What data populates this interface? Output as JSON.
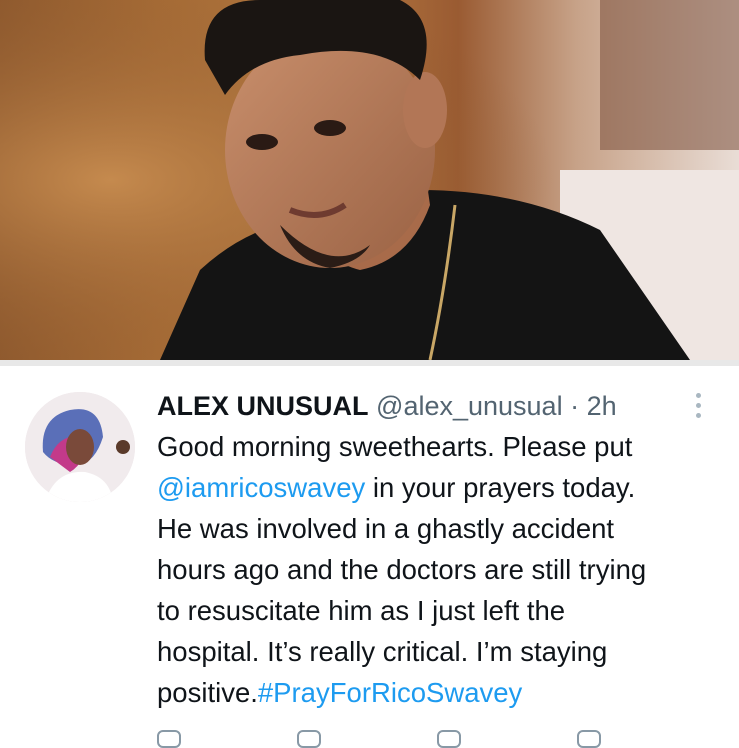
{
  "photo": {
    "subject": "Portrait of a young man with styled hair wearing a black shirt and a thin gold chain"
  },
  "tweet": {
    "author_name": "ALEX UNUSUAL",
    "handle": "@alex_unusual",
    "separator": "·",
    "time": "2h",
    "text_lines": [
      "Good morning sweethearts. Please put",
      {
        "mention": "@iamricoswavey",
        "rest": " in your prayers today."
      },
      "He was involved in a ghastly accident",
      "hours ago and the doctors are still trying",
      "to resuscitate him as I just left the",
      "hospital. It’s really critical. I’m staying",
      {
        "prefix": "positive.",
        "hashtag": "#PrayForRicoSwavey"
      }
    ]
  },
  "icons": {
    "more": "more-vertical-icon",
    "actions": [
      "reply-icon",
      "retweet-icon",
      "like-icon",
      "share-icon"
    ]
  },
  "colors": {
    "link": "#1d9bf0",
    "text": "#0f1419",
    "muted": "#536471"
  }
}
